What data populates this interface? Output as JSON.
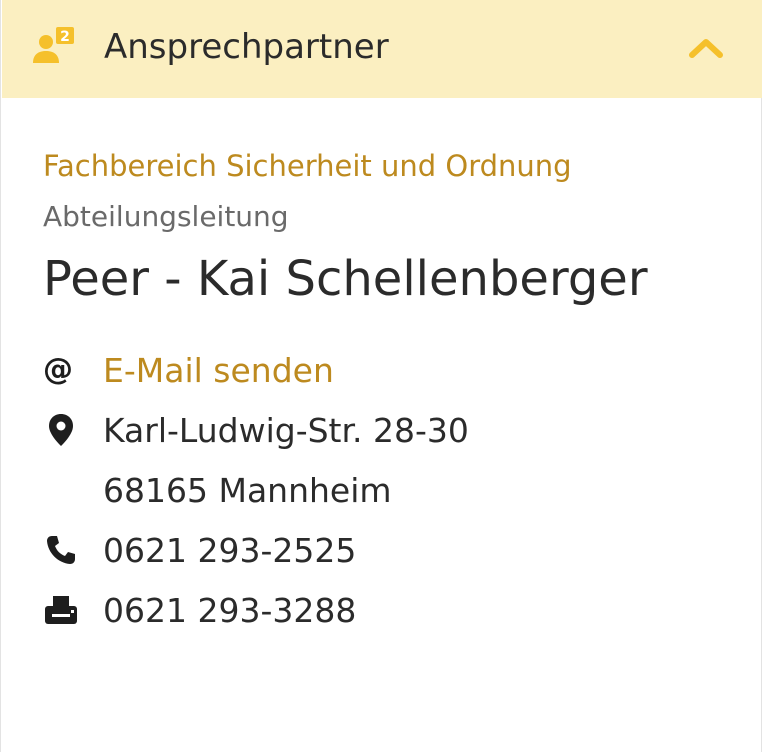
{
  "header": {
    "title": "Ansprechpartner",
    "icon": "contact-person-icon",
    "toggle_icon": "chevron-up-icon",
    "accent_color": "#f5c02b",
    "background_color": "#fbefc1"
  },
  "contact": {
    "department": "Fachbereich Sicherheit und Ordnung",
    "role": "Abteilungsleitung",
    "name": "Peer - Kai Schellenberger",
    "email_label": "E-Mail senden",
    "address_line1": "Karl-Ludwig-Str. 28-30",
    "address_line2": "68165 Mannheim",
    "phone": "0621 293-2525",
    "fax": "0621 293-3288"
  },
  "icons": {
    "email": "at-icon",
    "address": "location-pin-icon",
    "phone": "phone-icon",
    "fax": "fax-icon"
  },
  "colors": {
    "link": "#bd8a1f",
    "text": "#2b2b2b",
    "muted": "#6a6a6a"
  }
}
